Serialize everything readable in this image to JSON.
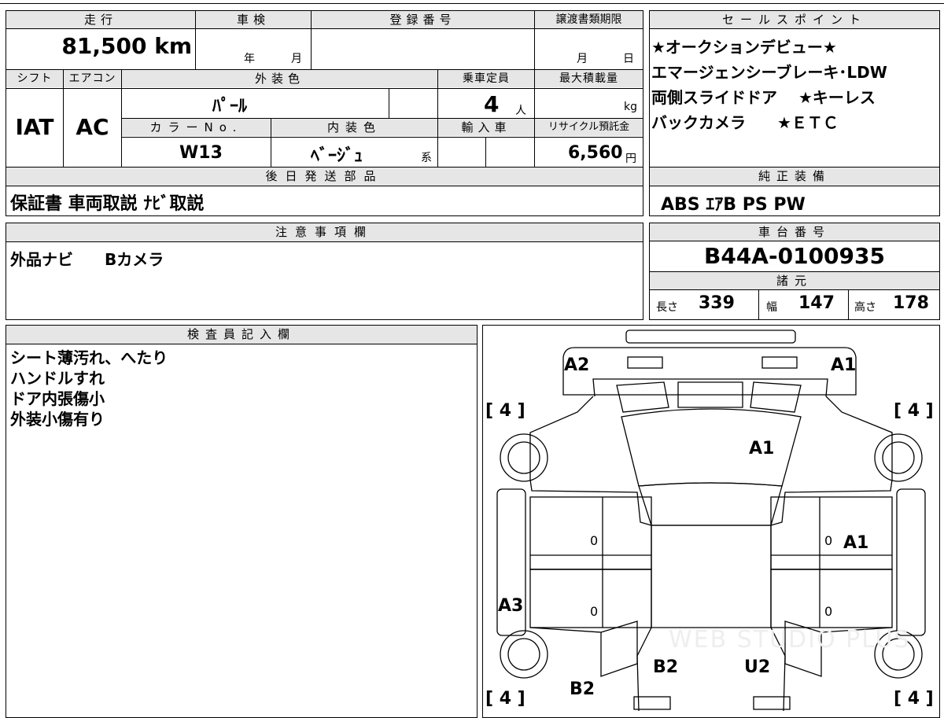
{
  "top_table": {
    "mileage_label": "走行",
    "mileage_value": "81,500 km",
    "inspection_label": "車検",
    "inspection_year": "年",
    "inspection_month": "月",
    "registration_label": "登録番号",
    "registration_value": "",
    "transfer_label": "譲渡書類期限",
    "transfer_month": "月",
    "transfer_day": "日",
    "shift_label": "シフト",
    "shift_value": "IAT",
    "aircon_label": "エアコン",
    "aircon_value": "AC",
    "exterior_color_label": "外装色",
    "exterior_color_value": "ﾊﾟｰﾙ",
    "capacity_label": "乗車定員",
    "capacity_value": "4",
    "capacity_unit": "人",
    "max_load_label": "最大積載量",
    "max_load_unit": "kg",
    "color_no_label": "カラーNo.",
    "color_no_value": "W13",
    "interior_color_label": "内装色",
    "interior_color_value": "ﾍﾞｰｼﾞｭ",
    "interior_color_suffix": "系",
    "import_label": "輸入車",
    "recycle_label": "リサイクル預託金",
    "recycle_value": "6,560",
    "recycle_unit": "円",
    "later_parts_label": "後日発送部品",
    "later_parts_value": "保証書 車両取説 ﾅﾋﾞ取説"
  },
  "sales_points": {
    "label": "セールスポイント",
    "lines": [
      "★オークションデビュー★",
      "エマージェンシーブレーキ･LDW",
      "両側スライドドア　 ★キーレス",
      "バックカメラ　　★ＥＴＣ"
    ]
  },
  "genuine_equipment": {
    "label": "純正装備",
    "value": "ABS ｴｱB PS PW"
  },
  "notes": {
    "label": "注意事項欄",
    "value": "外品ナビ　　Bカメラ"
  },
  "chassis": {
    "label": "車台番号",
    "value": "B44A-0100935"
  },
  "specs": {
    "label": "諸元",
    "length_label": "長さ",
    "length_value": "339",
    "width_label": "幅",
    "width_value": "147",
    "height_label": "高さ",
    "height_value": "178"
  },
  "inspector": {
    "label": "検査員記入欄",
    "lines": [
      "シート薄汚れ、へたり",
      "ハンドルすれ",
      "ドア内張傷小",
      "外装小傷有り"
    ]
  },
  "diagram": {
    "marks": {
      "front_left": "A2",
      "front_right": "A1",
      "hood": "A1",
      "right_side": "A1",
      "left_rear": "A3",
      "rear_left": "B2",
      "rear_center_left": "B2",
      "rear_center_right": "U2"
    },
    "tire_labels": [
      "[ 4 ]",
      "[ 4 ]",
      "[ 4 ]",
      "[ 4 ]"
    ],
    "zeros": [
      "0",
      "0",
      "0",
      "0"
    ],
    "watermark": "WEB STUDIO PLUS"
  }
}
